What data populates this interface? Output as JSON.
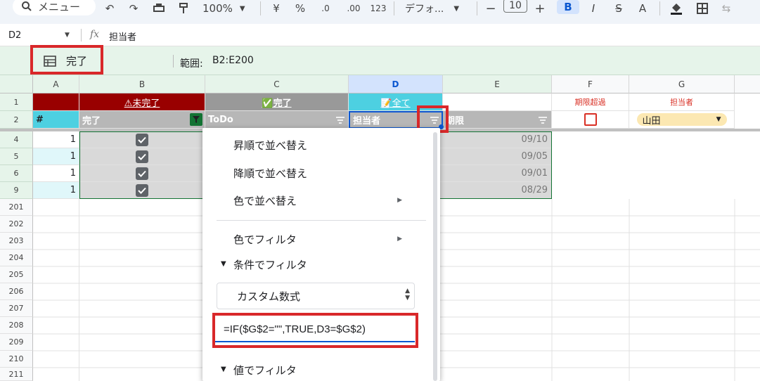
{
  "toolbar": {
    "menu_label": "メニュー",
    "zoom": "100%",
    "currency": "¥",
    "percent": "%",
    "dec_dec": ".0",
    "dec_inc": ".00",
    "number_format": "123",
    "font_name": "デフォ...",
    "font_size": "10",
    "bold": "B",
    "italic": "I",
    "strike": "S",
    "text_color": "A"
  },
  "formula_bar": {
    "name_box": "D2",
    "fx": "fx",
    "formula": "担当者"
  },
  "filter_view": {
    "name": "完了",
    "range_label": "範囲:",
    "range": "B2:E200"
  },
  "columns": [
    "A",
    "B",
    "C",
    "D",
    "E",
    "F",
    "G"
  ],
  "row1": {
    "num": "1",
    "b_label": "⚠未完了",
    "c_label": "✅完了",
    "d_label": "📝全て",
    "f_label": "期限超過",
    "g_label": "担当者"
  },
  "row2": {
    "num": "2",
    "a": "#",
    "b": "完了",
    "c": "ToDo",
    "d": "担当者",
    "e": "期限",
    "g_value": "山田"
  },
  "data_rows": [
    {
      "row": "4",
      "a": "1",
      "checked": true,
      "date": "09/10"
    },
    {
      "row": "5",
      "a": "1",
      "checked": true,
      "date": "09/05"
    },
    {
      "row": "6",
      "a": "1",
      "checked": true,
      "date": "09/01"
    },
    {
      "row": "9",
      "a": "1",
      "checked": true,
      "date": "08/29"
    }
  ],
  "empty_rows": [
    "201",
    "202",
    "203",
    "204",
    "205",
    "206",
    "207",
    "208",
    "209",
    "210",
    "211"
  ],
  "menu": {
    "sort_asc": "昇順で並べ替え",
    "sort_desc": "降順で並べ替え",
    "sort_color": "色で並べ替え",
    "filter_color": "色でフィルタ",
    "filter_condition": "条件でフィルタ",
    "condition_select": "カスタム数式",
    "formula_value": "=IF($G$2=\"\",TRUE,D3=$G$2)",
    "filter_values": "値でフィルタ"
  },
  "colors": {
    "dark_red": "#990000",
    "header_gray": "#b7b7b7",
    "cyan": "#4dd0e1",
    "highlight_red": "#d9282a",
    "filter_green": "#e6f4ea"
  }
}
